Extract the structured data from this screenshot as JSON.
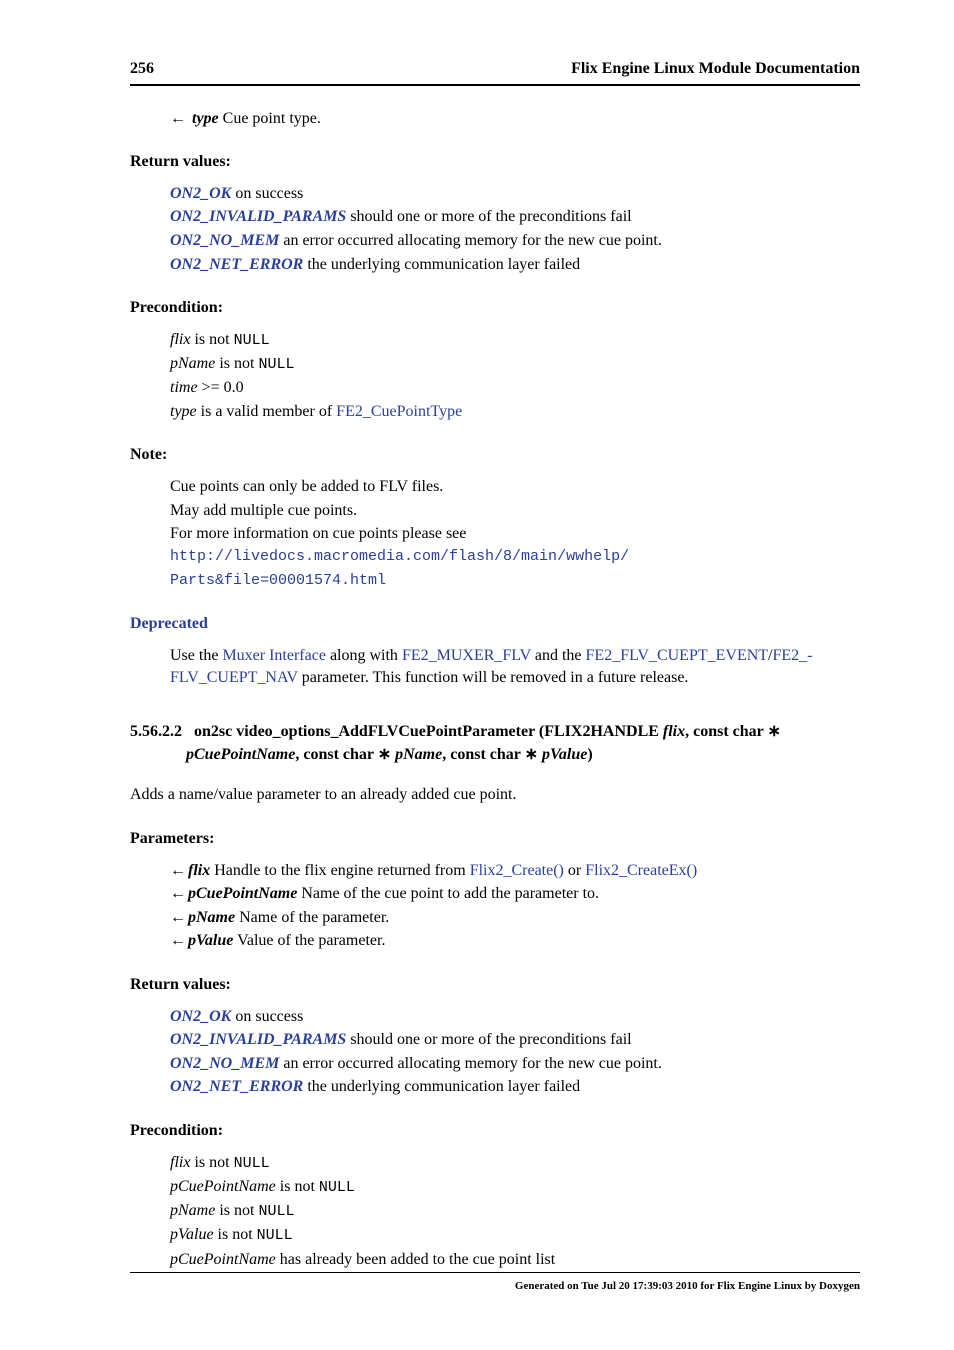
{
  "header": {
    "page_number": "256",
    "title": "Flix Engine Linux Module Documentation"
  },
  "top_param": {
    "arrow": "←",
    "name": "type",
    "desc": "Cue point type."
  },
  "retvals1": {
    "heading": "Return values:",
    "items": [
      {
        "key": "ON2_OK",
        "desc": "on success"
      },
      {
        "key": "ON2_INVALID_PARAMS",
        "desc": "should one or more of the preconditions fail"
      },
      {
        "key": "ON2_NO_MEM",
        "desc": "an error occurred allocating memory for the new cue point."
      },
      {
        "key": "ON2_NET_ERROR",
        "desc": "the underlying communication layer failed"
      }
    ]
  },
  "precond1": {
    "heading": "Precondition:",
    "lines": {
      "l1a": "flix",
      "l1b": " is not ",
      "l1c": "NULL",
      "l2a": "pName",
      "l2b": " is not ",
      "l2c": "NULL",
      "l3a": "time",
      "l3b": " >= 0.0",
      "l4a": "type",
      "l4b": " is a valid member of ",
      "l4c": "FE2_CuePointType"
    }
  },
  "note": {
    "heading": "Note:",
    "l1": "Cue points can only be added to FLV files.",
    "l2": "May add multiple cue points.",
    "l3a": "For more information on cue points please see ",
    "l3b": "http://livedocs.macromedia.com/flash/8/main/wwhelp/",
    "l4": "Parts&file=00001574.html"
  },
  "deprecated": {
    "label": "Deprecated",
    "t1": "Use the ",
    "l1": "Muxer Interface",
    "t2": " along with ",
    "l2": "FE2_MUXER_FLV",
    "t3": " and the ",
    "l3": "FE2_FLV_CUEPT_EVENT",
    "slash": "/",
    "l4": "FE2_-",
    "l5": "FLV_CUEPT_NAV",
    "t4": " parameter. This function will be removed in a future release."
  },
  "sec5562": {
    "num": "5.56.2.2",
    "sig_a": "on2sc video_options_AddFLVCuePointParameter (FLIX2HANDLE ",
    "sig_b": "flix",
    "sig_c": ", const char ∗",
    "sig_d": "pCuePointName",
    "sig_e": ", const char ∗ ",
    "sig_f": "pName",
    "sig_g": ", const char ∗ ",
    "sig_h": "pValue",
    "sig_i": ")",
    "desc": "Adds a name/value parameter to an already added cue point."
  },
  "params": {
    "heading": "Parameters:",
    "p1": {
      "arrow": "←",
      "name": "flix",
      "t1": "Handle to the flix engine returned from ",
      "l1": "Flix2_Create()",
      "t2": " or ",
      "l2": "Flix2_CreateEx()"
    },
    "p2": {
      "arrow": "←",
      "name": "pCuePointName",
      "desc": "Name of the cue point to add the parameter to."
    },
    "p3": {
      "arrow": "←",
      "name": "pName",
      "desc": "Name of the parameter."
    },
    "p4": {
      "arrow": "←",
      "name": "pValue",
      "desc": "Value of the parameter."
    }
  },
  "retvals2": {
    "heading": "Return values:",
    "items": [
      {
        "key": "ON2_OK",
        "desc": "on success"
      },
      {
        "key": "ON2_INVALID_PARAMS",
        "desc": "should one or more of the preconditions fail"
      },
      {
        "key": "ON2_NO_MEM",
        "desc": "an error occurred allocating memory for the new cue point."
      },
      {
        "key": "ON2_NET_ERROR",
        "desc": "the underlying communication layer failed"
      }
    ]
  },
  "precond2": {
    "heading": "Precondition:",
    "lines": {
      "l1a": "flix",
      "l1b": " is not ",
      "l1c": "NULL",
      "l2a": "pCuePointName",
      "l2b": " is not ",
      "l2c": "NULL",
      "l3a": "pName",
      "l3b": " is not ",
      "l3c": "NULL",
      "l4a": "pValue",
      "l4b": " is not ",
      "l4c": "NULL",
      "l5a": "pCuePointName",
      "l5b": " has already been added to the cue point list"
    }
  },
  "footer": "Generated on Tue Jul 20 17:39:03 2010 for Flix Engine Linux by Doxygen"
}
